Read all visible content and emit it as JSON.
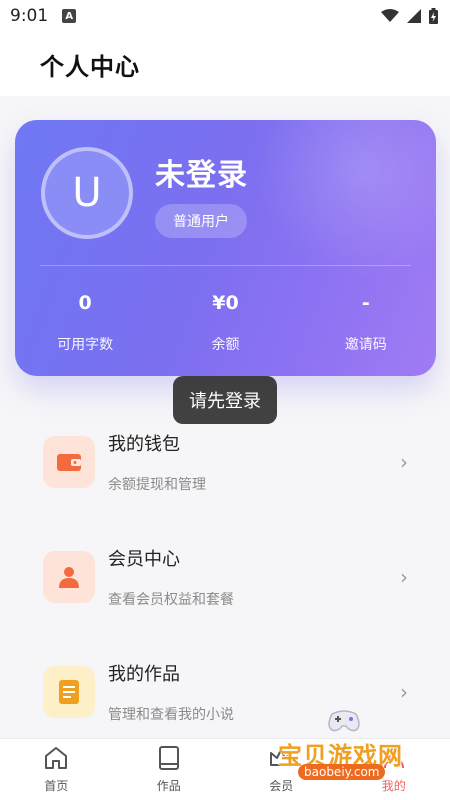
{
  "status_bar": {
    "time": "9:01",
    "a_badge": "A"
  },
  "header": {
    "title": "个人中心"
  },
  "profile": {
    "avatar_letter": "U",
    "username": "未登录",
    "user_type": "普通用户",
    "stats": [
      {
        "value": "0",
        "label": "可用字数"
      },
      {
        "value": "¥0",
        "label": "余额"
      },
      {
        "value": "-",
        "label": "邀请码"
      }
    ]
  },
  "toast": {
    "text": "请先登录"
  },
  "menu": {
    "items": [
      {
        "title": "我的钱包",
        "subtitle": "余额提现和管理",
        "icon": "wallet-icon",
        "bg": "#fde3d8",
        "color": "#f36a3e"
      },
      {
        "title": "会员中心",
        "subtitle": "查看会员权益和套餐",
        "icon": "user-icon",
        "bg": "#fde3d8",
        "color": "#f36a3e"
      },
      {
        "title": "我的作品",
        "subtitle": "管理和查看我的小说",
        "icon": "book-icon",
        "bg": "#fdf0c8",
        "color": "#f0a020"
      }
    ],
    "arrow": "›"
  },
  "bottom_nav": {
    "items": [
      {
        "label": "首页",
        "icon": "home-icon"
      },
      {
        "label": "作品",
        "icon": "book-outline-icon"
      },
      {
        "label": "会员",
        "icon": "crown-icon"
      },
      {
        "label": "我的",
        "icon": "profile-icon"
      }
    ],
    "active_color": "#f06060"
  },
  "watermark": {
    "text": "宝贝游戏网",
    "url": "baobeiy.com"
  },
  "colors": {
    "accent": "#7b6ff0",
    "background": "#f6f6f8"
  }
}
